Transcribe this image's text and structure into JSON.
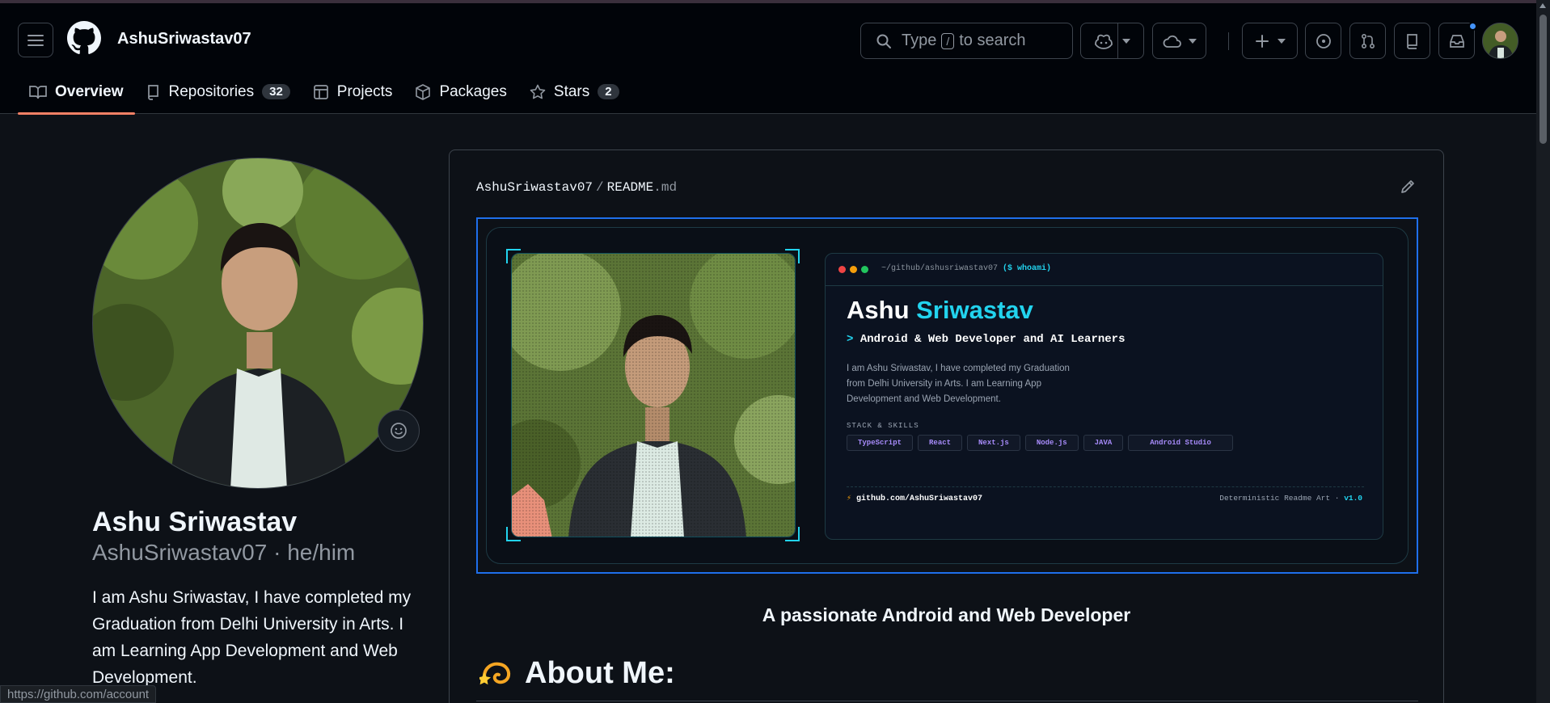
{
  "header": {
    "username": "AshuSriwastav07",
    "search": {
      "prefix": "Type",
      "key": "/",
      "suffix": "to search"
    }
  },
  "tabs": [
    {
      "label": "Overview",
      "active": true
    },
    {
      "label": "Repositories",
      "count": "32"
    },
    {
      "label": "Projects"
    },
    {
      "label": "Packages"
    },
    {
      "label": "Stars",
      "count": "2"
    }
  ],
  "profile": {
    "name": "Ashu Sriwastav",
    "handle": "AshuSriwastav07 · he/him",
    "bio": "I am Ashu Sriwastav, I have completed my Graduation from Delhi University in Arts. I am Learning App Development and Web Development."
  },
  "readme": {
    "owner": "AshuSriwastav07",
    "file": "README",
    "ext": ".md",
    "banner": {
      "term_path": "~/github/ashusriwastav07",
      "term_cmd": "($ whoami)",
      "first_name": "Ashu",
      "last_name": "Sriwastav",
      "role_prefix": ">",
      "role": "Android & Web Developer and AI Learners",
      "desc": "I am Ashu Sriwastav, I have completed my Graduation from Delhi University in Arts. I am Learning App Development and Web Development.",
      "stack_label": "STACK & SKILLS",
      "chips": [
        "TypeScript",
        "React",
        "Next.js",
        "Node.js",
        "JAVA",
        "Android Studio"
      ],
      "footer_link": "github.com/AshuSriwastav07",
      "footer_right": "Deterministic Readme Art ·",
      "version": "v1.0"
    },
    "tagline": "A passionate Android and Web Developer",
    "about_heading": "About Me:"
  },
  "status_url": "https://github.com/account",
  "colors": {
    "accent_tab": "#f78166",
    "link_blue": "#1f6feb",
    "cyan": "#22d3ee",
    "chip_purple": "#a78bfa"
  }
}
